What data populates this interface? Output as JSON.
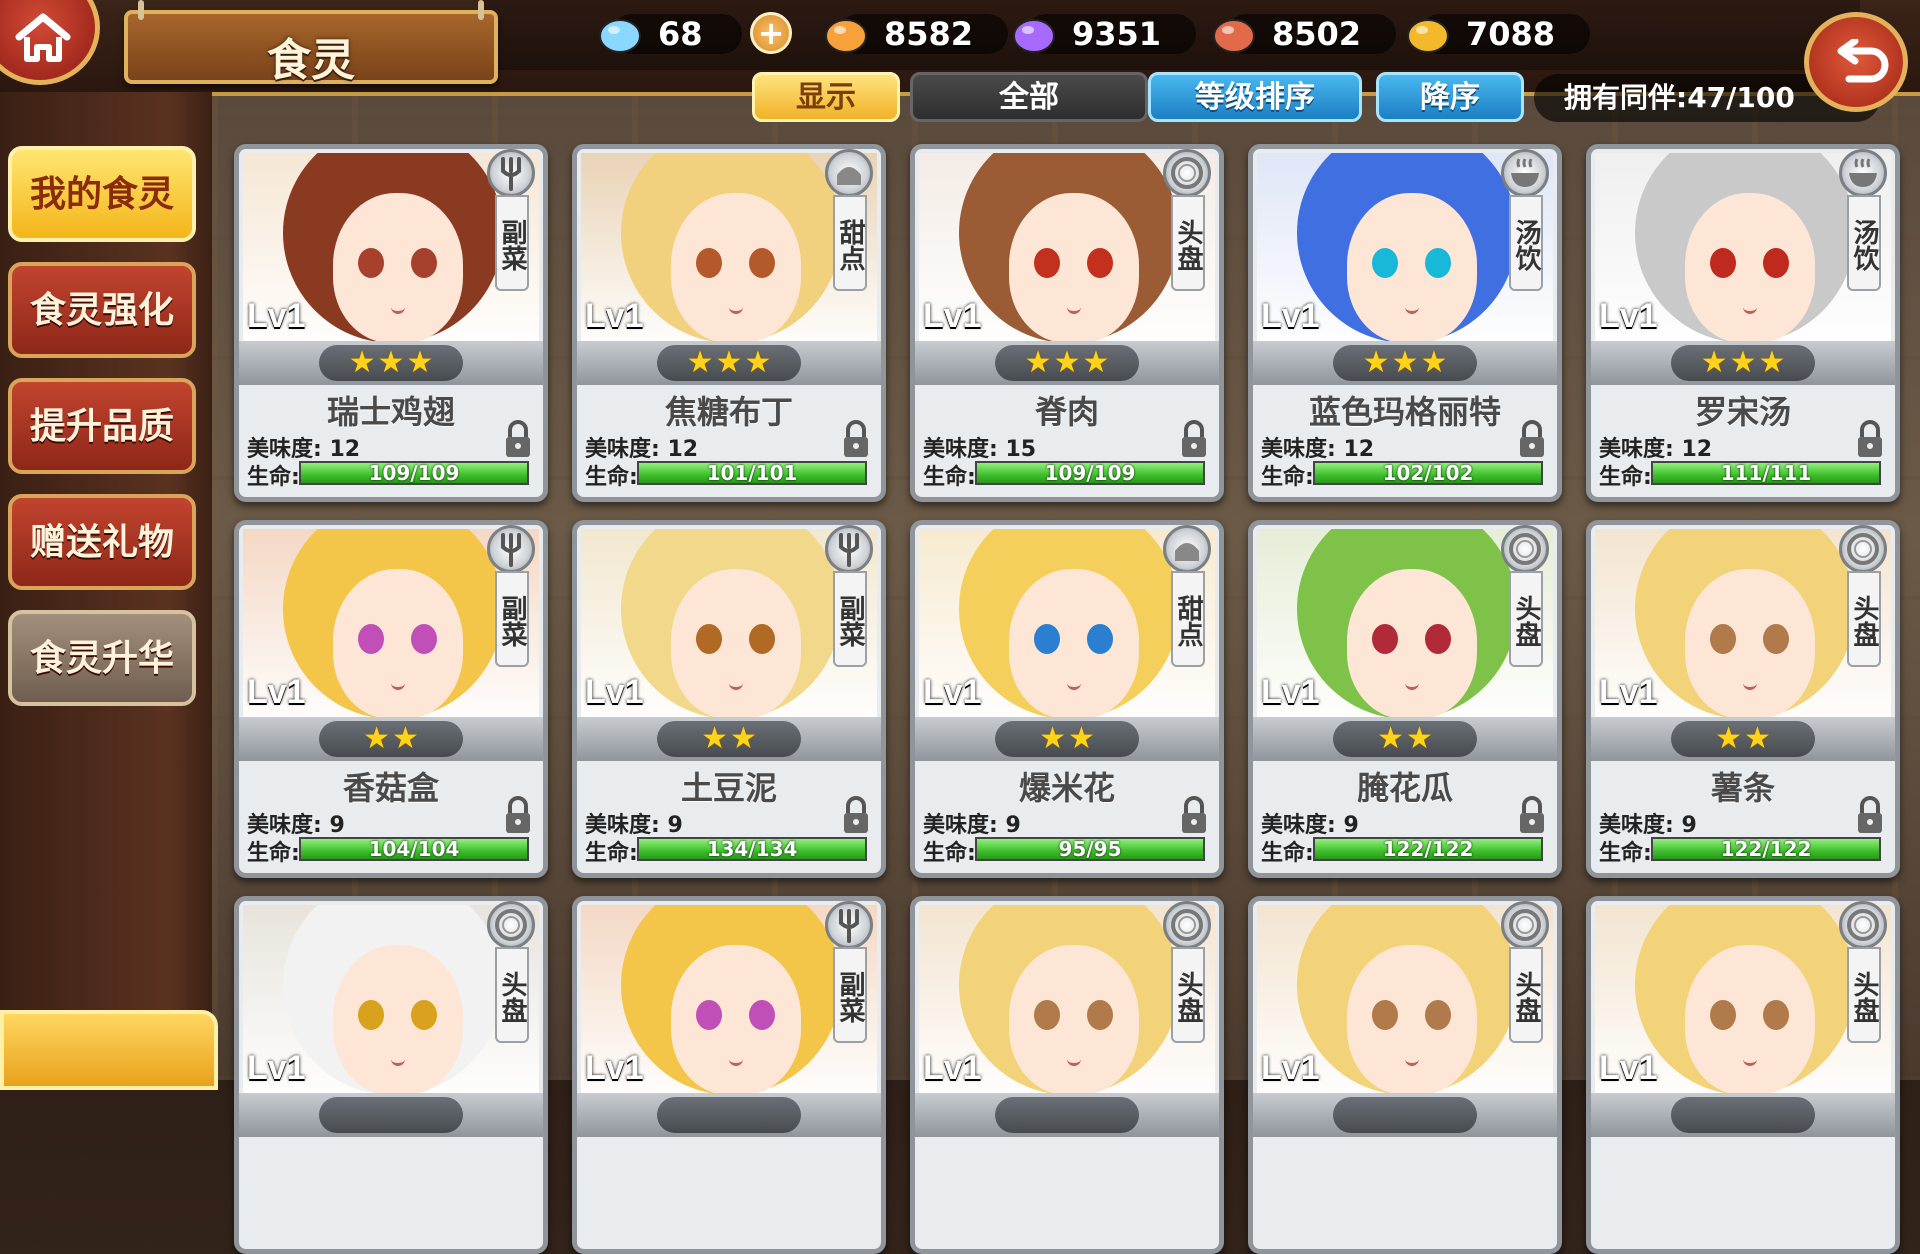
{
  "header": {
    "title": "食灵",
    "resources": [
      {
        "name": "diamond-icon",
        "value": "68",
        "color": "#8ad7ff"
      },
      {
        "name": "potion-icon",
        "value": "8582",
        "color": "#f7a13a"
      },
      {
        "name": "crystal-icon",
        "value": "9351",
        "color": "#a76aff"
      },
      {
        "name": "meat-icon",
        "value": "8502",
        "color": "#e06a4a"
      },
      {
        "name": "food-bowl-icon",
        "value": "7088",
        "color": "#f3b92a"
      }
    ],
    "plus_label": "+"
  },
  "filters": {
    "show": "显示",
    "all": "全部",
    "sort": "等级排序",
    "order": "降序",
    "owned": "拥有同伴:47/100"
  },
  "sidebar": {
    "items": [
      {
        "label": "我的食灵",
        "state": "active"
      },
      {
        "label": "食灵强化",
        "state": "normal"
      },
      {
        "label": "提升品质",
        "state": "normal"
      },
      {
        "label": "赠送礼物",
        "state": "normal"
      },
      {
        "label": "食灵升华",
        "state": "disabled"
      }
    ]
  },
  "cards": [
    {
      "name": "瑞士鸡翅",
      "level": "Lv1",
      "type": "副菜",
      "type_icon": "fork-icon",
      "stars": 3,
      "taste": "美味度: 12",
      "hp_label": "生命:",
      "hp": "109/109",
      "hp_ratio": 1,
      "hair": "#8b3a22",
      "eye": "#a8402e",
      "bg": "#f6e7d4"
    },
    {
      "name": "焦糖布丁",
      "level": "Lv1",
      "type": "甜点",
      "type_icon": "cake-icon",
      "stars": 3,
      "taste": "美味度: 12",
      "hp_label": "生命:",
      "hp": "101/101",
      "hp_ratio": 1,
      "hair": "#f1d17e",
      "eye": "#b45a2a",
      "bg": "#e9d3b6"
    },
    {
      "name": "脊肉",
      "level": "Lv1",
      "type": "头盘",
      "type_icon": "plate-icon",
      "stars": 3,
      "taste": "美味度: 15",
      "hp_label": "生命:",
      "hp": "109/109",
      "hp_ratio": 1,
      "hair": "#9a5b35",
      "eye": "#c3301e",
      "bg": "#f4ece6"
    },
    {
      "name": "蓝色玛格丽特",
      "level": "Lv1",
      "type": "汤饮",
      "type_icon": "soup-icon",
      "stars": 3,
      "taste": "美味度: 12",
      "hp_label": "生命:",
      "hp": "102/102",
      "hp_ratio": 1,
      "hair": "#3f6fe0",
      "eye": "#18b8d8",
      "bg": "#dfe6f6"
    },
    {
      "name": "罗宋汤",
      "level": "Lv1",
      "type": "汤饮",
      "type_icon": "soup-icon",
      "stars": 3,
      "taste": "美味度: 12",
      "hp_label": "生命:",
      "hp": "111/111",
      "hp_ratio": 1,
      "hair": "#c9c9c9",
      "eye": "#c02a1e",
      "bg": "#efefef"
    },
    {
      "name": "香菇盒",
      "level": "Lv1",
      "type": "副菜",
      "type_icon": "fork-icon",
      "stars": 2,
      "taste": "美味度: 9",
      "hp_label": "生命:",
      "hp": "104/104",
      "hp_ratio": 1,
      "hair": "#f3c64a",
      "eye": "#c050b8",
      "bg": "#f4d8c4"
    },
    {
      "name": "土豆泥",
      "level": "Lv1",
      "type": "副菜",
      "type_icon": "fork-icon",
      "stars": 2,
      "taste": "美味度: 9",
      "hp_label": "生命:",
      "hp": "134/134",
      "hp_ratio": 1,
      "hair": "#f1d88a",
      "eye": "#b06a24",
      "bg": "#f2e7cf"
    },
    {
      "name": "爆米花",
      "level": "Lv1",
      "type": "甜点",
      "type_icon": "cake-icon",
      "stars": 2,
      "taste": "美味度: 9",
      "hp_label": "生命:",
      "hp": "95/95",
      "hp_ratio": 1,
      "hair": "#f5cf5c",
      "eye": "#2a7fd0",
      "bg": "#f7ead0"
    },
    {
      "name": "腌花瓜",
      "level": "Lv1",
      "type": "头盘",
      "type_icon": "plate-icon",
      "stars": 2,
      "taste": "美味度: 9",
      "hp_label": "生命:",
      "hp": "122/122",
      "hp_ratio": 1,
      "hair": "#7ec24a",
      "eye": "#b02a3a",
      "bg": "#e6edd7"
    },
    {
      "name": "薯条",
      "level": "Lv1",
      "type": "头盘",
      "type_icon": "plate-icon",
      "stars": 2,
      "taste": "美味度: 9",
      "hp_label": "生命:",
      "hp": "122/122",
      "hp_ratio": 1,
      "hair": "#f2d37a",
      "eye": "#b07a4a",
      "bg": "#f3e4d0"
    },
    {
      "name": "",
      "level": "Lv1",
      "type": "头盘",
      "type_icon": "plate-icon",
      "stars": 0,
      "taste": "",
      "hp_label": "",
      "hp": "",
      "hp_ratio": 1,
      "hair": "#f2f2f2",
      "eye": "#d8a21e",
      "bg": "#e8e4dc"
    },
    {
      "name": "",
      "level": "Lv1",
      "type": "副菜",
      "type_icon": "fork-icon",
      "stars": 0,
      "taste": "",
      "hp_label": "",
      "hp": "",
      "hp_ratio": 1,
      "hair": "#f3c64a",
      "eye": "#c050b8",
      "bg": "#f4d8c4"
    },
    {
      "name": "",
      "level": "Lv1",
      "type": "头盘",
      "type_icon": "plate-icon",
      "stars": 0,
      "taste": "",
      "hp_label": "",
      "hp": "",
      "hp_ratio": 1,
      "hair": "#f2d37a",
      "eye": "#b07a4a",
      "bg": "#f3e4d0"
    },
    {
      "name": "",
      "level": "Lv1",
      "type": "头盘",
      "type_icon": "plate-icon",
      "stars": 0,
      "taste": "",
      "hp_label": "",
      "hp": "",
      "hp_ratio": 1,
      "hair": "#f2d37a",
      "eye": "#b07a4a",
      "bg": "#f3e4d0"
    },
    {
      "name": "",
      "level": "Lv1",
      "type": "头盘",
      "type_icon": "plate-icon",
      "stars": 0,
      "taste": "",
      "hp_label": "",
      "hp": "",
      "hp_ratio": 1,
      "hair": "#f2d37a",
      "eye": "#b07a4a",
      "bg": "#f3e4d0"
    }
  ]
}
